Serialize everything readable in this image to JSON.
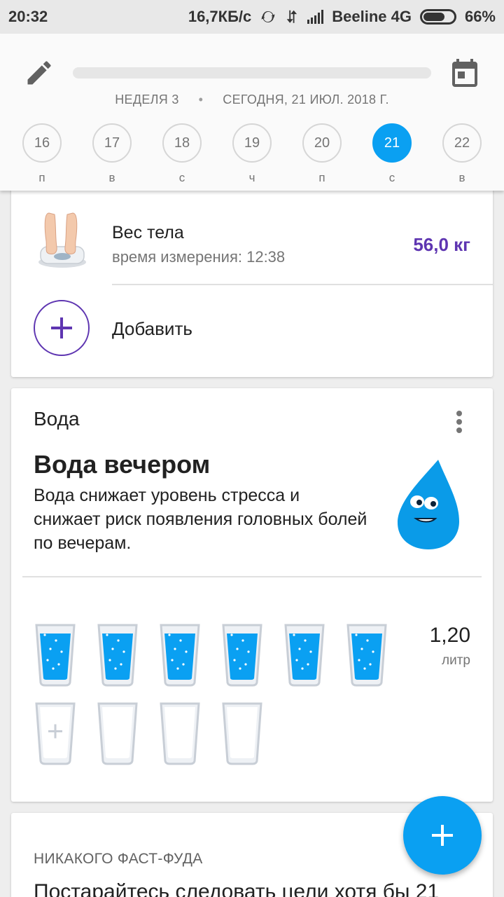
{
  "status_bar": {
    "time": "20:32",
    "speed": "16,7КБ/с",
    "carrier": "Beeline 4G",
    "battery": "66%"
  },
  "header": {
    "edit_icon": "pencil-icon",
    "calendar_icon": "calendar-icon",
    "week": "НЕДЕЛЯ 3",
    "separator": "•",
    "date": "СЕГОДНЯ, 21 ИЮЛ. 2018 Г.",
    "days": [
      {
        "num": "16",
        "letter": "п"
      },
      {
        "num": "17",
        "letter": "в"
      },
      {
        "num": "18",
        "letter": "с"
      },
      {
        "num": "19",
        "letter": "ч"
      },
      {
        "num": "20",
        "letter": "п"
      },
      {
        "num": "21",
        "letter": "с",
        "active": true
      },
      {
        "num": "22",
        "letter": "в"
      }
    ]
  },
  "weight_card": {
    "title": "Вес тела",
    "subtitle": "время измерения: 12:38",
    "value": "56,0 кг",
    "add_label": "Добавить"
  },
  "water_card": {
    "title": "Вода",
    "tip_title": "Вода вечером",
    "tip_text": "Вода снижает уровень стресса и снижает риск появления головных болей по вечерам.",
    "litres": "1,20",
    "unit": "литр",
    "glasses_filled": 6,
    "glasses_total": 10
  },
  "fastfood_card": {
    "title": "НИКАКОГО ФАСТ-ФУДА",
    "text": "Постарайтесь следовать цели хотя бы 21"
  },
  "colors": {
    "accent": "#0aa0f2",
    "purple": "#5e35b1"
  }
}
